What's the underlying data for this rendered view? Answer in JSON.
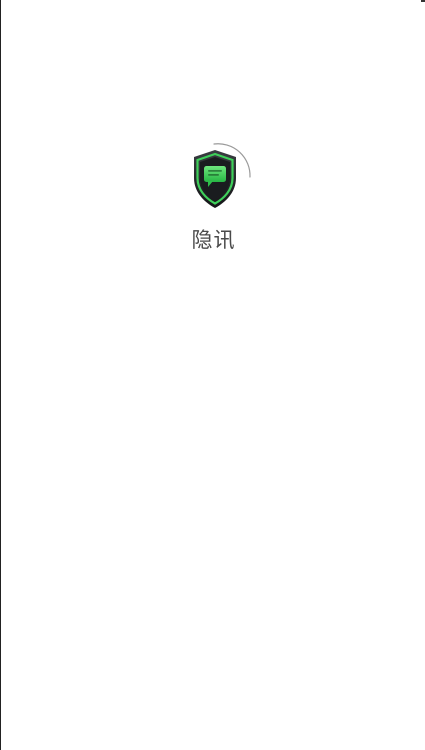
{
  "splash": {
    "app_name": "隐讯",
    "logo_icon": "shield-chat-icon",
    "loading_indicator": "arc-spinner",
    "colors": {
      "background": "#ffffff",
      "shield_dark": "#1d1f22",
      "shield_accent": "#3ecf5a",
      "text": "#4a4a4a"
    }
  }
}
